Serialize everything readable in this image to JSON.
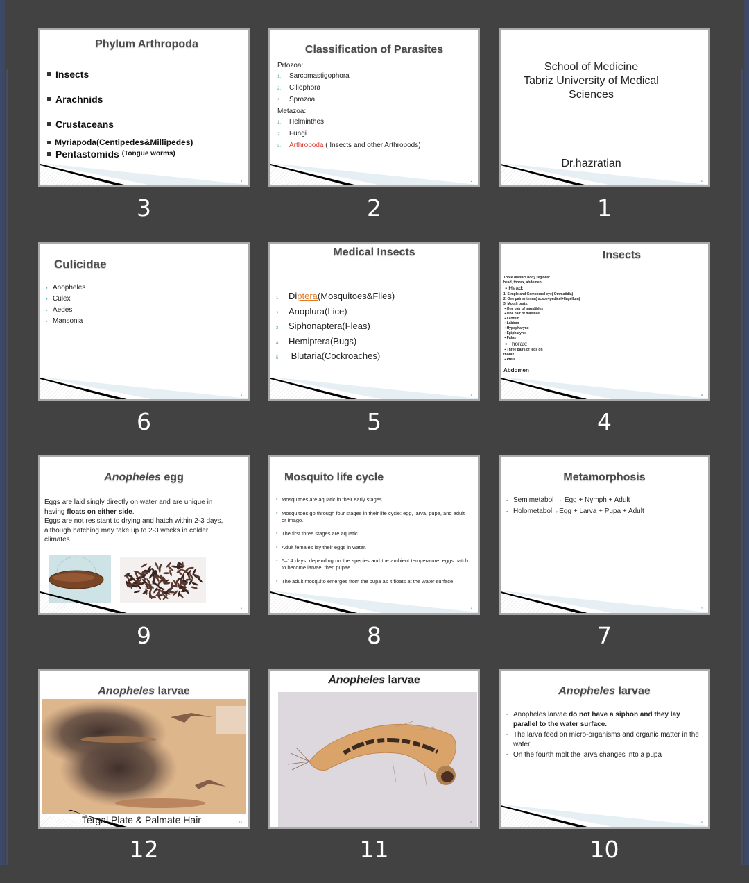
{
  "slides": [
    {
      "number": "3",
      "page_label": "3",
      "title": "Phylum Arthropoda",
      "items": [
        "Insects",
        "Arachnids",
        "Crustaceans",
        "Myriapoda(Centipedes&Millipedes)",
        "Pentastomids"
      ],
      "items_note": "(Tongue worms)"
    },
    {
      "number": "2",
      "page_label": "2",
      "title": "Classification of Parasites",
      "group1_label": "Prtozoa:",
      "group1_items": [
        "Sarcomastigophora",
        "Ciliophora",
        "Sprozoa"
      ],
      "group2_label": "Metazoa:",
      "group2_items": [
        "Helminthes",
        "Fungi"
      ],
      "group2_highlight": "Arthropoda",
      "group2_highlight_note": " ( Insects and other Arthropods)",
      "highlight_color": "#e03a2f"
    },
    {
      "number": "1",
      "page_label": "1",
      "title_lines": [
        "School of Medicine",
        "Tabriz University of Medical",
        "Sciences"
      ],
      "author": "Dr.hazratian"
    },
    {
      "number": "6",
      "page_label": "6",
      "title": "Culicidae",
      "items": [
        "Anopheles",
        "Culex",
        "Aedes",
        "Mansonia"
      ]
    },
    {
      "number": "5",
      "page_label": "5",
      "title": "Medical Insects",
      "item1_pre": "Di",
      "item1_mid": "ptera",
      "item1_post": "(Mosquitoes&Flies)",
      "items": [
        "Anoplura(Lice)",
        "Siphonaptera(Fleas)",
        "Hemiptera(Bugs)",
        " Blutaria(Cockroaches)"
      ]
    },
    {
      "number": "4",
      "page_label": "4",
      "title": "Insects",
      "intro": "Three distinct body regions: head, thorax, abdomen.",
      "head_label": "Head:",
      "head_items": [
        "1.   Simple and Compound eye( Ommatidia)",
        "2.   One pair antenna( scape+pedicel+flagellum)",
        "3.   Mouth parts:"
      ],
      "mouth_parts": [
        "One pair of mandibles",
        "One pair of maxillae",
        "Labrum",
        "Labium",
        "Hypopharynx",
        "Epipharynx",
        "Palps"
      ],
      "thorax_label": "Thorax:",
      "thorax_items": [
        "Three pairs of legs on thorax",
        "Ptera"
      ],
      "abdomen_label": "Abdomen"
    },
    {
      "number": "9",
      "page_label": "9",
      "title_italic": "Anopheles",
      "title_rest": "  egg",
      "para1_pre": "Eggs are laid singly directly on water and are unique in having ",
      "para1_bold": "floats on either side",
      "para1_post": ".",
      "para2": " Eggs are not resistant to drying and hatch within 2-3 days, although hatching may take up to 2-3 weeks in colder climates",
      "image1": "single-anopheles-egg-photo",
      "image2": "cluster-of-eggs-photo"
    },
    {
      "number": "8",
      "page_label": "8",
      "title": "Mosquito life cycle",
      "items": [
        "Mosquitoes are aquatic in their early stages.",
        " Mosquitoes go through four stages in their life cycle: egg, larva, pupa, and adult or imago.",
        " The first three stages are aquatic.",
        " Adult females lay their eggs in water.",
        " 5–14 days, depending on the species and the ambient temperature; eggs hatch to become larvae, then pupae.",
        " The adult mosquito emerges from the pupa as it floats at the water surface."
      ]
    },
    {
      "number": "7",
      "page_label": "7",
      "title": "Metamorphosis",
      "items": [
        "Semimetabol → Egg + Nymph + Adult",
        "Holometabol→Egg + Larva + Pupa + Adult"
      ]
    },
    {
      "number": "12",
      "page_label": "12",
      "title_italic": "Anopheles",
      "title_rest": " larvae",
      "caption": "Tergal Plate & Palmate Hair",
      "image": "larva-tergal-plate-microscope-photo"
    },
    {
      "number": "11",
      "page_label": "11",
      "title_italic": "Anopheles",
      "title_rest": " larvae",
      "image": "anopheles-larva-photo"
    },
    {
      "number": "10",
      "page_label": "10",
      "title_italic": "Anopheles",
      "title_rest": "  larvae",
      "item1_pre": "Anopheles larvae ",
      "item1_bold": "do not have a siphon and they lay parallel to the water surface.",
      "items": [
        " The larva feed on micro-organisms and organic matter in the water.",
        " On the fourth molt the larva changes into a pupa"
      ]
    }
  ],
  "colors": {
    "background": "#424242",
    "thumbnail_border": "#a9a9a9",
    "bullet_accent": "#5b9bb0",
    "highlight_red": "#e03a2f",
    "highlight_orange": "#e07b2a"
  }
}
